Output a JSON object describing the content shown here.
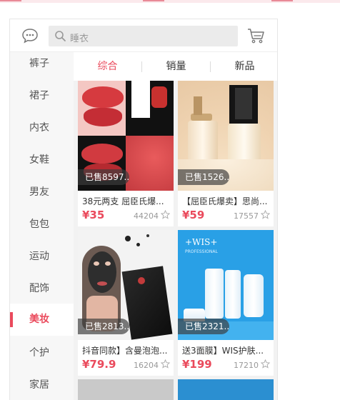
{
  "search": {
    "placeholder": "睡衣"
  },
  "sidebar": {
    "items": [
      {
        "label": "裤子"
      },
      {
        "label": "裙子"
      },
      {
        "label": "内衣"
      },
      {
        "label": "女鞋"
      },
      {
        "label": "男友"
      },
      {
        "label": "包包"
      },
      {
        "label": "运动"
      },
      {
        "label": "配饰"
      },
      {
        "label": "美妆",
        "active": true
      },
      {
        "label": "个护"
      },
      {
        "label": "家居"
      }
    ]
  },
  "sort_tabs": [
    {
      "label": "综合",
      "active": true
    },
    {
      "label": "销量"
    },
    {
      "label": "新品"
    }
  ],
  "products": [
    {
      "sold": "已售8597...",
      "title": "38元两支 屈臣氏爆...",
      "price": "¥35",
      "sales": "44204"
    },
    {
      "sold": "已售1526...",
      "title": "【屈臣氏爆卖】思尚...",
      "price": "¥59",
      "sales": "17557"
    },
    {
      "sold": "已售2813...",
      "title": "抖音同款】含曼泡泡...",
      "price": "¥79.9",
      "sales": "16204"
    },
    {
      "sold": "已售2321...",
      "title": "送3面膜】WIS护肤...",
      "price": "¥199",
      "sales": "17210"
    }
  ],
  "product_images": {
    "wis_brand": "+WIS+",
    "wis_sub": "PROFESSIONAL"
  },
  "colors": {
    "accent": "#ea4a5c",
    "sidebar_bg": "#f7f7f7",
    "wis_bg": "#29a0e6"
  },
  "icons": [
    "chat-bubble-icon",
    "search-icon",
    "cart-icon",
    "star-icon"
  ]
}
